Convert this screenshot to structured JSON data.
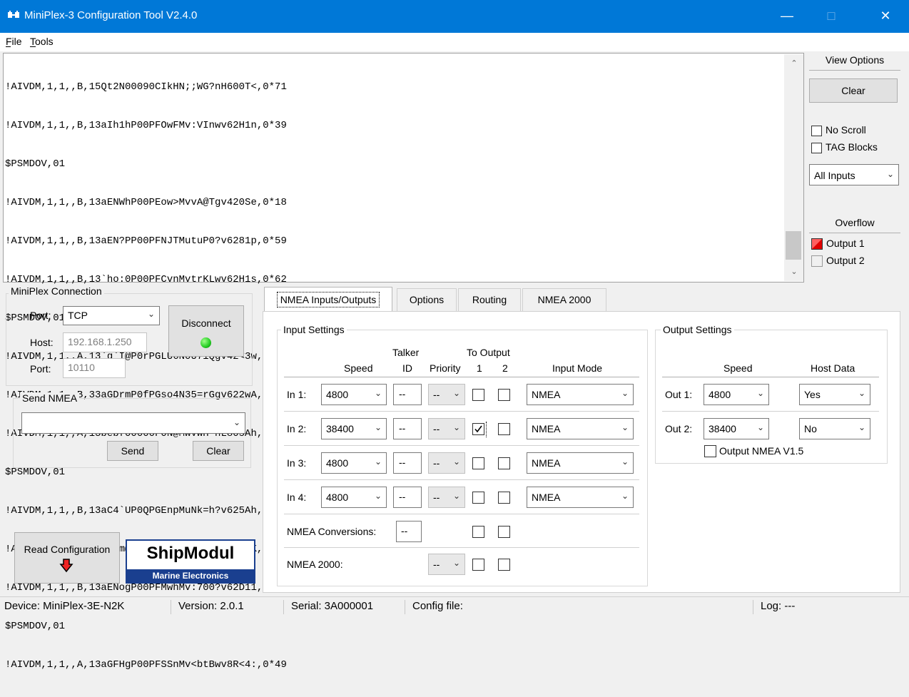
{
  "window": {
    "title": "MiniPlex-3 Configuration Tool V2.4.0",
    "minimize": "—",
    "maximize": "□",
    "close": "✕"
  },
  "menu": [
    "File",
    "Tools"
  ],
  "log": {
    "lines": [
      "!AIVDM,1,1,,B,15Qt2N00090CIkHN;;WG?nH600T<,0*71",
      "!AIVDM,1,1,,B,13aIh1hP00PFOwFMv:VInwv62H1n,0*39",
      "$PSMDOV,01",
      "!AIVDM,1,1,,B,13aENWhP00PEow>MvvA@Tgv420Se,0*18",
      "!AIVDM,1,1,,B,13aEN?PP00PFNJTMutuP0?v6281p,0*59",
      "!AIVDM,1,1,,B,13`ho:0P00PFCvnMvtrKLwv62H1s,0*62",
      "$PSMDOV,01",
      "!AIVDM,1,1,,A,13`g`I@P0rPGLU6N0U7iQgv42<3w,0*2B",
      "!AIVDM,1,1,,B,33aGDrmP0fPGso4N35=rGgv622wA,0*30",
      "!AIVDM,1,1,,A,13bebf00000F0N@MwVWH`hL805Ah,0*4C",
      "$PSMDOV,01",
      "!AIVDM,1,1,,B,13aC4`UP0QPGEnpMuNk=h?v625Ah,0*60",
      "!AIVDM,1,1,,B,13aGDm@P00PFL:<Mv=K5mwvv0D3K,0*0A",
      "!AIVDM,1,1,,B,13aENogP00PFMwhMv:700?v62D11,0*33",
      "$PSMDOV,01",
      "!AIVDM,1,1,,A,13aGFHgP00PFSSnMv<btBwv8R<4:,0*49"
    ]
  },
  "view_options": {
    "title": "View Options",
    "clear": "Clear",
    "no_scroll": "No Scroll",
    "tag_blocks": "TAG Blocks",
    "inputs_select": "All Inputs",
    "overflow_title": "Overflow",
    "output1": "Output 1",
    "output2": "Output 2",
    "overflow_color": "#e00000"
  },
  "connection": {
    "title": "MiniPlex Connection",
    "port_label": "Port:",
    "port_value": "TCP",
    "host_label": "Host:",
    "host_value": "192.168.1.250",
    "port2_label": "Port:",
    "port2_value": "10110",
    "disconnect": "Disconnect",
    "led_color": "#22cc22"
  },
  "send_nmea": {
    "title": "Send NMEA",
    "value": "",
    "send": "Send",
    "clear": "Clear"
  },
  "read_config": "Read Configuration",
  "logo": {
    "brand": "ShipModul",
    "tagline": "Marine Electronics"
  },
  "tabs": [
    "NMEA Inputs/Outputs",
    "Options",
    "Routing",
    "NMEA 2000"
  ],
  "input_settings": {
    "title": "Input Settings",
    "h_speed": "Speed",
    "h_talker1": "Talker",
    "h_talker2": "ID",
    "h_priority": "Priority",
    "h_to_output": "To Output",
    "h_out1": "1",
    "h_out2": "2",
    "h_mode": "Input Mode",
    "rows": [
      {
        "label": "In 1:",
        "speed": "4800",
        "talker": "--",
        "priority": "--",
        "out1": false,
        "out2": false,
        "mode": "NMEA"
      },
      {
        "label": "In 2:",
        "speed": "38400",
        "talker": "--",
        "priority": "--",
        "out1": true,
        "out2": false,
        "mode": "NMEA"
      },
      {
        "label": "In 3:",
        "speed": "4800",
        "talker": "--",
        "priority": "--",
        "out1": false,
        "out2": false,
        "mode": "NMEA"
      },
      {
        "label": "In 4:",
        "speed": "4800",
        "talker": "--",
        "priority": "--",
        "out1": false,
        "out2": false,
        "mode": "NMEA"
      }
    ],
    "conversions_label": "NMEA Conversions:",
    "conversions_talker": "--",
    "n2k_label": "NMEA 2000:",
    "n2k_priority": "--"
  },
  "output_settings": {
    "title": "Output Settings",
    "h_speed": "Speed",
    "h_host": "Host Data",
    "rows": [
      {
        "label": "Out 1:",
        "speed": "4800",
        "host": "Yes"
      },
      {
        "label": "Out 2:",
        "speed": "38400",
        "host": "No"
      }
    ],
    "nmea15": "Output NMEA V1.5"
  },
  "status": {
    "device": "Device: MiniPlex-3E-N2K",
    "version": "Version: 2.0.1",
    "serial": "Serial: 3A000001",
    "config": "Config file:",
    "log": "Log: ---"
  }
}
